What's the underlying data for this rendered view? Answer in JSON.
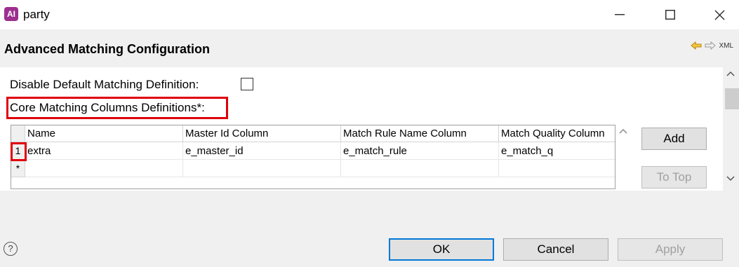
{
  "window": {
    "app_icon_text": "AI",
    "title": "party",
    "minimize": "—",
    "maximize": "☐",
    "close": "✕"
  },
  "header": {
    "title": "Advanced Matching Configuration",
    "nav_back": "⇦",
    "nav_forward": "⇨",
    "xml_label": "XML"
  },
  "form": {
    "disable_default_label": "Disable Default Matching Definition:",
    "disable_default_checked": false,
    "core_columns_label": "Core Matching Columns Definitions*:"
  },
  "table": {
    "columns": [
      "Name",
      "Master Id Column",
      "Match Rule Name Column",
      "Match Quality Column"
    ],
    "rows": [
      {
        "index": "1",
        "cells": [
          "extra",
          "e_master_id",
          "e_match_rule",
          "e_match_q"
        ]
      }
    ],
    "new_row_marker": "*"
  },
  "side_buttons": {
    "add": "Add",
    "to_top": "To Top"
  },
  "footer": {
    "help": "?",
    "ok": "OK",
    "cancel": "Cancel",
    "apply": "Apply"
  },
  "colors": {
    "highlight": "#e0000b",
    "app_icon": "#9c2f8f",
    "default_button_border": "#0078d7"
  }
}
